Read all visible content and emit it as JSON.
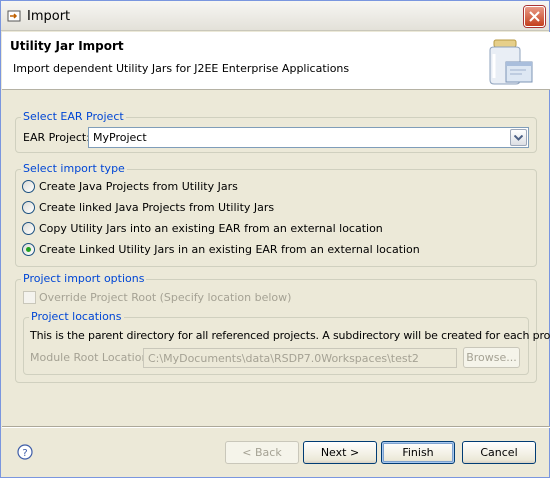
{
  "window": {
    "title": "Import"
  },
  "header": {
    "title": "Utility Jar Import",
    "description": "Import dependent Utility Jars for J2EE Enterprise Applications"
  },
  "ear_group": {
    "legend": "Select EAR Project",
    "label": "EAR Project:",
    "selected": "MyProject"
  },
  "import_type": {
    "legend": "Select import type",
    "options": [
      {
        "label": "Create Java Projects from Utility Jars",
        "checked": false
      },
      {
        "label": "Create linked Java Projects from Utility Jars",
        "checked": false
      },
      {
        "label": "Copy Utility Jars into an existing EAR from an external location",
        "checked": false
      },
      {
        "label": "Create Linked Utility Jars in an existing EAR from an external location",
        "checked": true
      }
    ]
  },
  "options_group": {
    "legend": "Project import options",
    "override_label": "Override Project Root (Specify location below)",
    "locations": {
      "legend": "Project locations",
      "info": "This is the parent directory for all referenced projects. A subdirectory will be created for each project.",
      "module_label": "Module Root Location:",
      "module_value": "C:\\MyDocuments\\data\\RSDP7.0Workspaces\\test2",
      "browse_label": "Browse..."
    }
  },
  "buttons": {
    "back": "< Back",
    "next": "Next >",
    "finish": "Finish",
    "cancel": "Cancel"
  }
}
